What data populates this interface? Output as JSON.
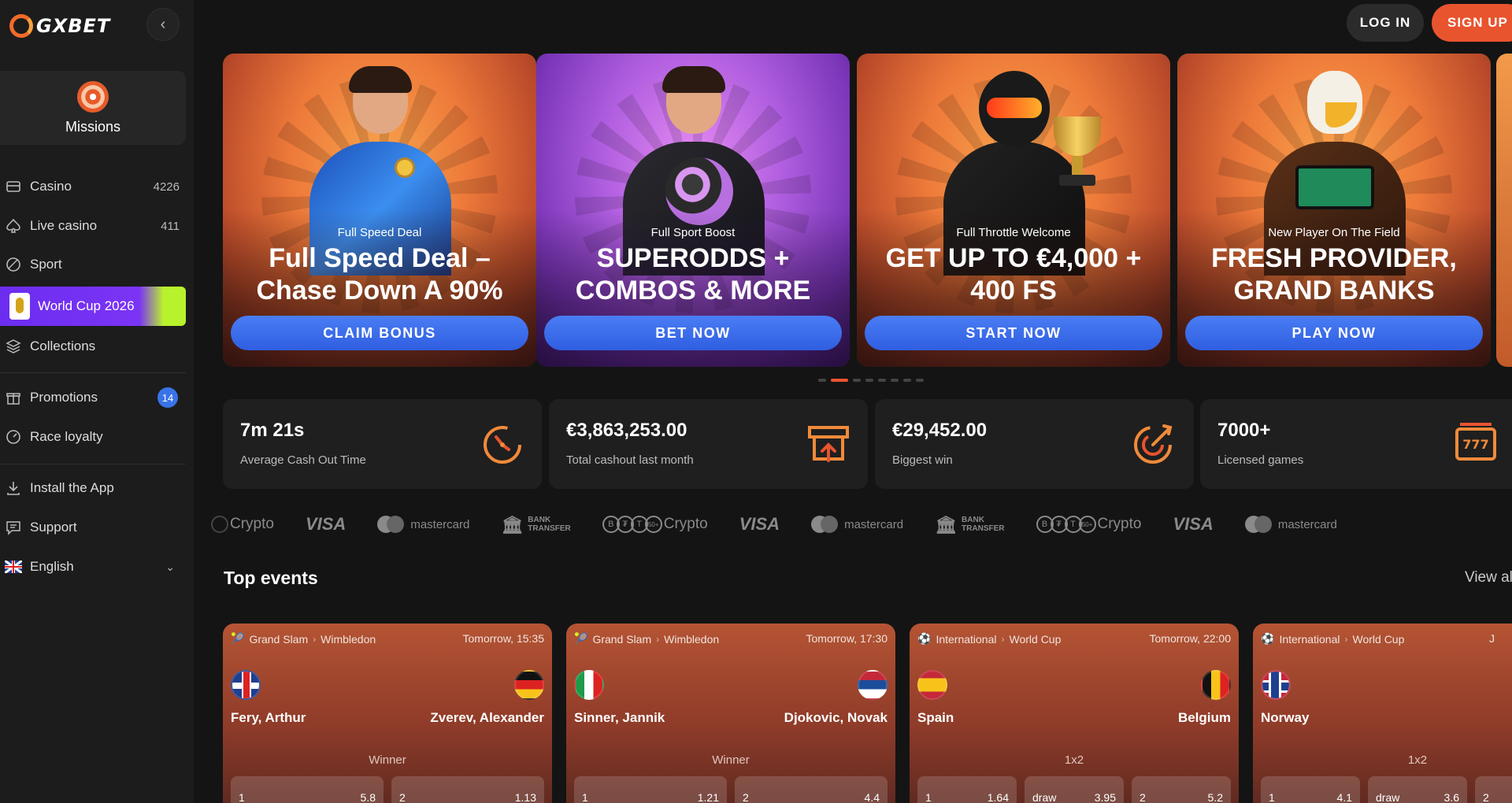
{
  "brand": {
    "name": "GXBET"
  },
  "header": {
    "login_label": "LOG IN",
    "signup_label": "SIGN UP"
  },
  "sidebar": {
    "missions_label": "Missions",
    "items": [
      {
        "label": "Casino",
        "count": "4226",
        "icon": "cards-icon"
      },
      {
        "label": "Live casino",
        "count": "411",
        "icon": "spade-icon"
      },
      {
        "label": "Sport",
        "icon": "ball-icon"
      },
      {
        "label": "World Cup 2026",
        "icon": "world-cup-logo"
      },
      {
        "label": "Collections",
        "icon": "layers-icon"
      },
      {
        "label": "Promotions",
        "badge": "14",
        "icon": "gift-icon"
      },
      {
        "label": "Race loyalty",
        "icon": "speedometer-icon"
      },
      {
        "label": "Install the App",
        "icon": "download-icon"
      },
      {
        "label": "Support",
        "icon": "chat-icon"
      },
      {
        "label": "English",
        "icon": "uk-flag-icon"
      }
    ]
  },
  "banners": [
    {
      "subtitle": "Full Speed Deal",
      "title": "Full Speed Deal – Chase Down A 90%",
      "button": "CLAIM BONUS"
    },
    {
      "subtitle": "Full Sport Boost",
      "title": "SUPERODDS + COMBOS & MORE",
      "button": "BET NOW"
    },
    {
      "subtitle": "Full Throttle Welcome",
      "title": "GET UP TO €4,000 + 400 FS",
      "button": "START NOW"
    },
    {
      "subtitle": "New Player On The Field",
      "title": "FRESH PROVIDER, GRAND BANKS",
      "button": "PLAY NOW"
    }
  ],
  "carousel": {
    "total": 8,
    "active": 2
  },
  "stats": [
    {
      "value": "7m 21s",
      "label": "Average Cash Out Time",
      "icon": "timer-icon"
    },
    {
      "value": "€3,863,253.00",
      "label": "Total cashout last month",
      "icon": "cashout-icon"
    },
    {
      "value": "€29,452.00",
      "label": "Biggest win",
      "icon": "target-icon"
    },
    {
      "value": "7000+",
      "label": "Licensed games",
      "icon": "slot-machine-icon"
    }
  ],
  "payments": {
    "crypto": "Crypto",
    "visa": "VISA",
    "mastercard": "mastercard",
    "bank_line1": "BANK",
    "bank_line2": "TRANSFER",
    "coins": [
      "B",
      "₮",
      "T",
      "50+"
    ]
  },
  "top_events": {
    "title": "Top events",
    "view_all": "View all",
    "events": [
      {
        "category": "Grand Slam",
        "league": "Wimbledon",
        "time": "Tomorrow, 15:35",
        "home": "Fery, Arthur",
        "away": "Zverev, Alexander",
        "market": "Winner",
        "odds": [
          {
            "label": "1",
            "value": "5.8"
          },
          {
            "label": "2",
            "value": "1.13"
          }
        ]
      },
      {
        "category": "Grand Slam",
        "league": "Wimbledon",
        "time": "Tomorrow, 17:30",
        "home": "Sinner, Jannik",
        "away": "Djokovic, Novak",
        "market": "Winner",
        "odds": [
          {
            "label": "1",
            "value": "1.21"
          },
          {
            "label": "2",
            "value": "4.4"
          }
        ]
      },
      {
        "category": "International",
        "league": "World Cup",
        "time": "Tomorrow, 22:00",
        "home": "Spain",
        "away": "Belgium",
        "market": "1x2",
        "odds": [
          {
            "label": "1",
            "value": "1.64"
          },
          {
            "label": "draw",
            "value": "3.95"
          },
          {
            "label": "2",
            "value": "5.2"
          }
        ]
      },
      {
        "category": "International",
        "league": "World Cup",
        "time": "J",
        "home": "Norway",
        "away": "",
        "market": "1x2",
        "odds": [
          {
            "label": "1",
            "value": "4.1"
          },
          {
            "label": "draw",
            "value": "3.6"
          },
          {
            "label": "2",
            "value": ""
          }
        ]
      }
    ]
  },
  "colors": {
    "accent": "#e8542e",
    "button_blue": "#3a6ee8",
    "sidebar_bg": "#1c1c1c",
    "page_bg": "#141414"
  }
}
